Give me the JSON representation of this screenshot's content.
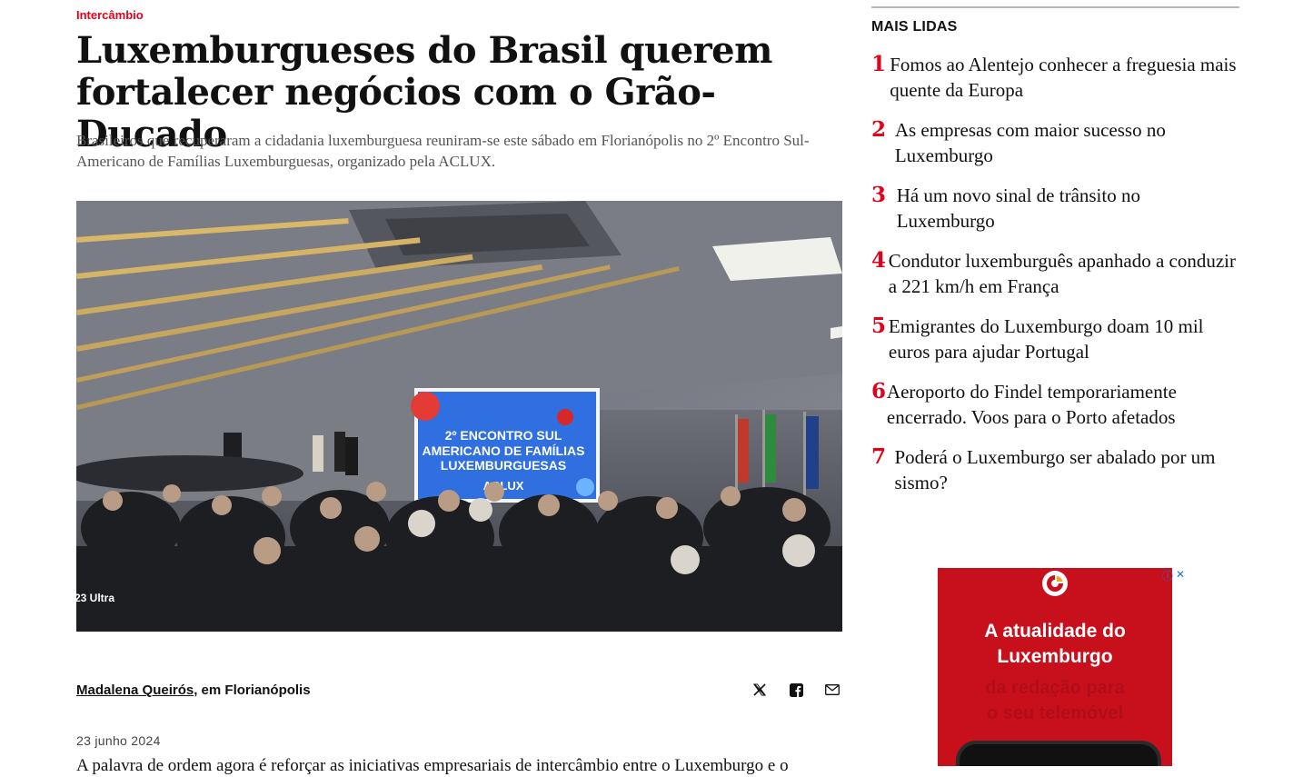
{
  "article": {
    "kicker": "Intercâmbio",
    "headline": "Luxemburgueses do Brasil querem fortalecer negócios com o Grão-Ducado",
    "lede": "Brasileiros que recuperaram a cidadania luxemburguesa reuniram-se este sábado em Florianópolis no 2º Encontro Sul-Americano de Famílias Luxemburguesas, organizado pela ACLUX.",
    "image": {
      "screen_line1": "2º ENCONTRO SUL",
      "screen_line2": "AMERICANO DE FAMÍLIAS",
      "screen_line3": "LUXEMBURGUESAS",
      "screen_line4": "ACLUX",
      "watermark": "23 Ultra"
    },
    "author": "Madalena Queirós",
    "location": ", em Florianópolis",
    "date": "23 junho 2024",
    "body_start": "A palavra de ordem agora é reforçar as iniciativas empresariais de intercâmbio entre o Luxemburgo e o"
  },
  "share": {
    "icons": [
      "x-icon",
      "facebook-icon",
      "email-icon"
    ]
  },
  "sidebar": {
    "title": "MAIS LIDAS",
    "items": [
      {
        "num": "1",
        "title": "Fomos ao Alentejo conhecer a freguesia mais quente da Europa"
      },
      {
        "num": "2",
        "title": "As empresas com maior sucesso no Luxemburgo"
      },
      {
        "num": "3",
        "title": "Há um novo sinal de trânsito no Luxemburgo"
      },
      {
        "num": "4",
        "title": "Condutor luxemburguês apanhado a conduzir a 221 km/h em França"
      },
      {
        "num": "5",
        "title": "Emigrantes do Luxemburgo doam 10 mil euros para ajudar Portugal"
      },
      {
        "num": "6",
        "title": "Aeroporto do Findel temporariamente encerrado. Voos para o Porto afetados"
      },
      {
        "num": "7",
        "title": "Poderá o Luxemburgo ser abalado por um sismo?"
      }
    ]
  },
  "ad": {
    "headline_line1": "A atualidade do",
    "headline_line2": "Luxemburgo",
    "sub_line1": "da redação para",
    "sub_line2": "o seu telemóvel",
    "colors": {
      "background": "#c8101d",
      "accent": "#e3001b"
    }
  }
}
